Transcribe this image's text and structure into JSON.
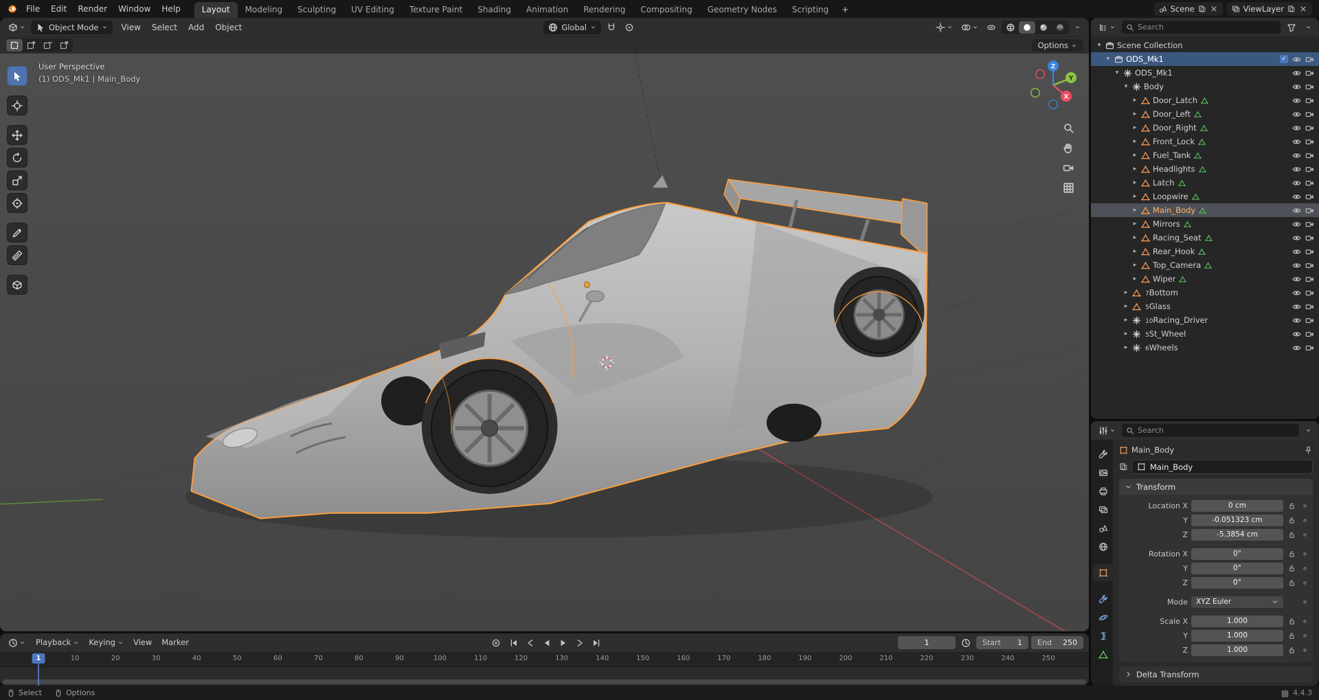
{
  "topbar": {
    "app_menus": [
      "File",
      "Edit",
      "Render",
      "Window",
      "Help"
    ],
    "workspaces": [
      "Layout",
      "Modeling",
      "Sculpting",
      "UV Editing",
      "Texture Paint",
      "Shading",
      "Animation",
      "Rendering",
      "Compositing",
      "Geometry Nodes",
      "Scripting"
    ],
    "active_workspace": "Layout",
    "add_label": "+",
    "scene_label": "Scene",
    "viewlayer_label": "ViewLayer"
  },
  "viewport": {
    "header": {
      "mode": "Object Mode",
      "menus": [
        "View",
        "Select",
        "Add",
        "Object"
      ],
      "orientation": "Global",
      "options_label": "Options"
    },
    "overlay": {
      "line1": "User Perspective",
      "line2": "(1) ODS_Mk1 | Main_Body"
    },
    "axis": {
      "x": "X",
      "y": "Y",
      "z": "Z"
    },
    "tools": [
      "select-box",
      "cursor",
      "move",
      "rotate",
      "scale",
      "transform",
      "annotate",
      "measure",
      "add-cube"
    ]
  },
  "outliner": {
    "search_placeholder": "Search",
    "rows": [
      {
        "label": "Scene Collection",
        "depth": 0,
        "icon": "collection",
        "arrow": "down"
      },
      {
        "label": "ODS_Mk1",
        "depth": 1,
        "icon": "collection",
        "arrow": "down",
        "selected": true,
        "checkbox": true,
        "eye": true,
        "cam": true
      },
      {
        "label": "ODS_Mk1",
        "depth": 2,
        "icon": "empty",
        "arrow": "down",
        "eye": true,
        "cam": true
      },
      {
        "label": "Body",
        "depth": 3,
        "icon": "empty",
        "arrow": "down",
        "eye": true,
        "cam": true
      },
      {
        "label": "Door_Latch",
        "depth": 4,
        "icon": "mesh",
        "arrow": "right",
        "data": true,
        "eye": true,
        "cam": true
      },
      {
        "label": "Door_Left",
        "depth": 4,
        "icon": "mesh",
        "arrow": "right",
        "data": true,
        "eye": true,
        "cam": true
      },
      {
        "label": "Door_Right",
        "depth": 4,
        "icon": "mesh",
        "arrow": "right",
        "data": true,
        "eye": true,
        "cam": true
      },
      {
        "label": "Front_Lock",
        "depth": 4,
        "icon": "mesh",
        "arrow": "right",
        "data": true,
        "eye": true,
        "cam": true
      },
      {
        "label": "Fuel_Tank",
        "depth": 4,
        "icon": "mesh",
        "arrow": "right",
        "data": true,
        "eye": true,
        "cam": true
      },
      {
        "label": "Headlights",
        "depth": 4,
        "icon": "mesh",
        "arrow": "right",
        "data": true,
        "eye": true,
        "cam": true
      },
      {
        "label": "Latch",
        "depth": 4,
        "icon": "mesh",
        "arrow": "right",
        "data": true,
        "eye": true,
        "cam": true
      },
      {
        "label": "Loopwire",
        "depth": 4,
        "icon": "mesh",
        "arrow": "right",
        "data": true,
        "eye": true,
        "cam": true
      },
      {
        "label": "Main_Body",
        "depth": 4,
        "icon": "mesh",
        "arrow": "right",
        "data": true,
        "active": true,
        "eye": true,
        "cam": true
      },
      {
        "label": "Mirrors",
        "depth": 4,
        "icon": "mesh",
        "arrow": "right",
        "data": true,
        "eye": true,
        "cam": true
      },
      {
        "label": "Racing_Seat",
        "depth": 4,
        "icon": "mesh",
        "arrow": "right",
        "data": true,
        "eye": true,
        "cam": true
      },
      {
        "label": "Rear_Hook",
        "depth": 4,
        "icon": "mesh",
        "arrow": "right",
        "data": true,
        "eye": true,
        "cam": true
      },
      {
        "label": "Top_Camera",
        "depth": 4,
        "icon": "mesh",
        "arrow": "right",
        "data": true,
        "eye": true,
        "cam": true
      },
      {
        "label": "Wiper",
        "depth": 4,
        "icon": "mesh",
        "arrow": "right",
        "data": true,
        "eye": true,
        "cam": true
      },
      {
        "label": "Bottom",
        "depth": 3,
        "icon": "mesh",
        "arrow": "right",
        "badge": "7",
        "eye": true,
        "cam": true
      },
      {
        "label": "Glass",
        "depth": 3,
        "icon": "mesh",
        "arrow": "right",
        "badge": "5",
        "eye": true,
        "cam": true
      },
      {
        "label": "Racing_Driver",
        "depth": 3,
        "icon": "empty",
        "arrow": "right",
        "badge": "10",
        "eye": true,
        "cam": true
      },
      {
        "label": "St_Wheel",
        "depth": 3,
        "icon": "empty",
        "arrow": "right",
        "badge": "5",
        "eye": true,
        "cam": true
      },
      {
        "label": "Wheels",
        "depth": 3,
        "icon": "empty",
        "arrow": "right",
        "badge": "6",
        "eye": true,
        "cam": true
      }
    ]
  },
  "properties": {
    "search_placeholder": "Search",
    "breadcrumb": "Main_Body",
    "name_value": "Main_Body",
    "tabs": [
      "tool",
      "render",
      "output",
      "viewlayer",
      "scene",
      "world",
      "object",
      "modifiers",
      "physics",
      "constraints",
      "data"
    ],
    "active_tab": "object",
    "transform": {
      "title": "Transform",
      "rows": [
        {
          "label": "Location X",
          "value": "0 cm",
          "kind": "number"
        },
        {
          "label": "Y",
          "value": "-0.051323 cm",
          "kind": "number"
        },
        {
          "label": "Z",
          "value": "-5.3854 cm",
          "kind": "number"
        },
        {
          "label": "Rotation X",
          "value": "0°",
          "kind": "number",
          "gap_before": true
        },
        {
          "label": "Y",
          "value": "0°",
          "kind": "number"
        },
        {
          "label": "Z",
          "value": "0°",
          "kind": "number"
        },
        {
          "label": "Mode",
          "value": "XYZ Euler",
          "kind": "dropdown",
          "gap_before": true
        },
        {
          "label": "Scale X",
          "value": "1.000",
          "kind": "number",
          "gap_before": true
        },
        {
          "label": "Y",
          "value": "1.000",
          "kind": "number"
        },
        {
          "label": "Z",
          "value": "1.000",
          "kind": "number"
        }
      ]
    },
    "delta_label": "Delta Transform"
  },
  "timeline": {
    "menus": [
      "Playback",
      "Keying",
      "View",
      "Marker"
    ],
    "transport": [
      "jump-start",
      "prev-keyframe",
      "play-reverse",
      "play",
      "next-keyframe",
      "jump-end"
    ],
    "current_frame": "1",
    "start_label": "Start",
    "start_value": "1",
    "end_label": "End",
    "end_value": "250",
    "ticks": [
      10,
      20,
      30,
      40,
      50,
      60,
      70,
      80,
      90,
      100,
      110,
      120,
      130,
      140,
      150,
      160,
      170,
      180,
      190,
      200,
      210,
      220,
      230,
      240,
      250
    ]
  },
  "statusbar": {
    "left": [
      "Select",
      "Options"
    ],
    "version": "4.4.3"
  },
  "colors": {
    "selection_outline": "#ff9d3c",
    "accent_blue": "#4c77bd",
    "axis_x": "#ef4d62",
    "axis_y": "#8ac543",
    "axis_z": "#3c82dc"
  }
}
